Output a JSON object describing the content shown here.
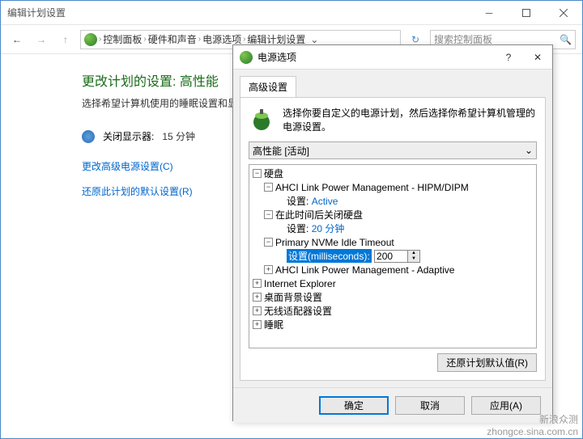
{
  "window": {
    "title": "编辑计划设置"
  },
  "breadcrumb": {
    "items": [
      "控制面板",
      "硬件和声音",
      "电源选项",
      "编辑计划设置"
    ]
  },
  "search": {
    "placeholder": "搜索控制面板"
  },
  "page": {
    "heading": "更改计划的设置: 高性能",
    "subtitle": "选择希望计算机使用的睡眠设置和显示",
    "display_off_label": "关闭显示器:",
    "display_off_value": "15 分钟",
    "link_advanced": "更改高级电源设置(C)",
    "link_restore": "还原此计划的默认设置(R)"
  },
  "dialog": {
    "title": "电源选项",
    "tab": "高级设置",
    "description": "选择你要自定义的电源计划，然后选择你希望计算机管理的电源设置。",
    "plan_selected": "高性能 [活动]",
    "tree": {
      "hard_disk": "硬盘",
      "ahci_hipm": "AHCI Link Power Management - HIPM/DIPM",
      "setting_label": "设置:",
      "ahci_hipm_value": "Active",
      "turn_off_after": "在此时间后关闭硬盘",
      "turn_off_value": "20 分钟",
      "nvme_timeout": "Primary NVMe Idle Timeout",
      "nvme_setting_label": "设置(milliseconds):",
      "nvme_value": "200",
      "ahci_adaptive": "AHCI Link Power Management - Adaptive",
      "ie": "Internet Explorer",
      "desktop_bg": "桌面背景设置",
      "wireless": "无线适配器设置",
      "sleep": "睡眠"
    },
    "restore_defaults": "还原计划默认值(R)",
    "ok": "确定",
    "cancel": "取消",
    "apply": "应用(A)"
  },
  "watermark": {
    "l1": "新浪众测",
    "l2": "zhongce.sina.com.cn"
  }
}
